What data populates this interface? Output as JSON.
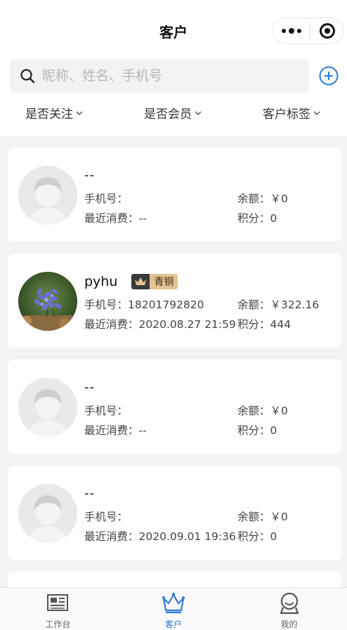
{
  "nav": {
    "title": "客户"
  },
  "search": {
    "placeholder": "昵称、姓名、手机号"
  },
  "filters": [
    {
      "label": "是否关注"
    },
    {
      "label": "是否会员"
    },
    {
      "label": "客户标签"
    }
  ],
  "customers": [
    {
      "name": "--",
      "phone_label": "手机号：",
      "phone": "",
      "balance_label": "余额：",
      "balance": "￥0",
      "recent_label": "最近消费：",
      "recent": "--",
      "points_label": "积分：",
      "points": "0",
      "avatar": "default-avatar"
    },
    {
      "name": "pyhu",
      "badge": "青铜",
      "phone_label": "手机号：",
      "phone": "18201792820",
      "balance_label": "余额：",
      "balance": "￥322.16",
      "recent_label": "最近消费：",
      "recent": "2020.08.27 21:59",
      "points_label": "积分：",
      "points": "444",
      "avatar": "flower-photo"
    },
    {
      "name": "--",
      "phone_label": "手机号：",
      "phone": "",
      "balance_label": "余额：",
      "balance": "￥0",
      "recent_label": "最近消费：",
      "recent": "--",
      "points_label": "积分：",
      "points": "0",
      "avatar": "default-avatar"
    },
    {
      "name": "--",
      "phone_label": "手机号：",
      "phone": "",
      "balance_label": "余额：",
      "balance": "￥0",
      "recent_label": "最近消费：",
      "recent": "2020.09.01 19:36",
      "points_label": "积分：",
      "points": "0",
      "avatar": "default-avatar"
    }
  ],
  "tabs": [
    {
      "label": "工作台",
      "icon": "workbench-icon",
      "active": false
    },
    {
      "label": "客户",
      "icon": "crown-icon",
      "active": true
    },
    {
      "label": "我的",
      "icon": "profile-icon",
      "active": false
    }
  ],
  "colors": {
    "accent": "#2d7cd6",
    "badge_dark": "#3a3a3a",
    "badge_gold": "#e2c38f"
  }
}
